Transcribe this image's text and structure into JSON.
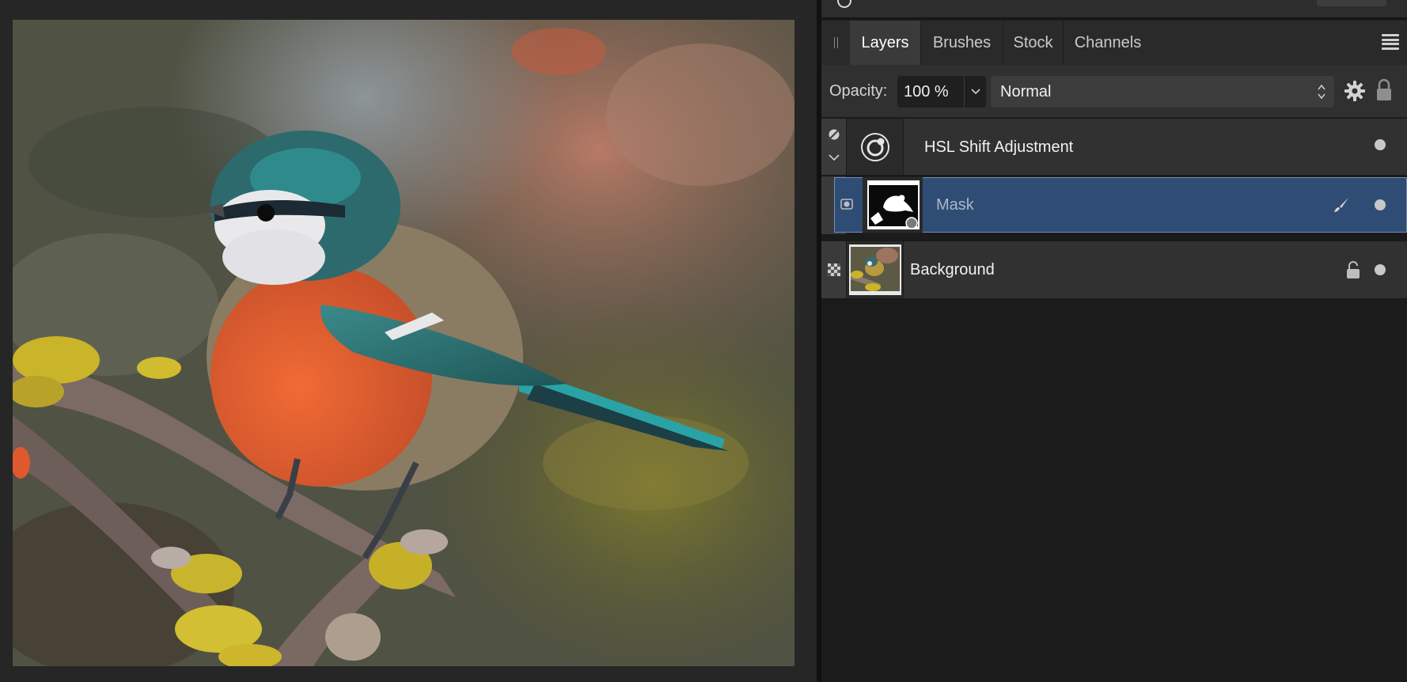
{
  "app": {
    "panel_tabs": [
      "Layers",
      "Brushes",
      "Stock",
      "Channels"
    ],
    "active_tab": "Layers"
  },
  "controls": {
    "opacity_label": "Opacity:",
    "opacity_value": "100 %",
    "blend_mode": "Normal"
  },
  "layers": [
    {
      "name": "HSL Shift Adjustment",
      "type": "adjustment",
      "expanded": true,
      "visible": true,
      "selected": false
    },
    {
      "name": "Mask",
      "type": "mask",
      "visible": true,
      "selected": true
    },
    {
      "name": "Background",
      "type": "pixel",
      "locked": true,
      "visible": true,
      "selected": false
    }
  ],
  "icons": {
    "panel_menu": "hamburger-menu-icon",
    "settings": "gear-icon",
    "lock": "lock-icon",
    "brush": "brush-icon",
    "adjustment": "hsl-adjustment-icon"
  },
  "colors": {
    "selection": "#2f4c74",
    "panel_bg": "#1b1b1b",
    "tab_active": "#3a3a3a"
  }
}
